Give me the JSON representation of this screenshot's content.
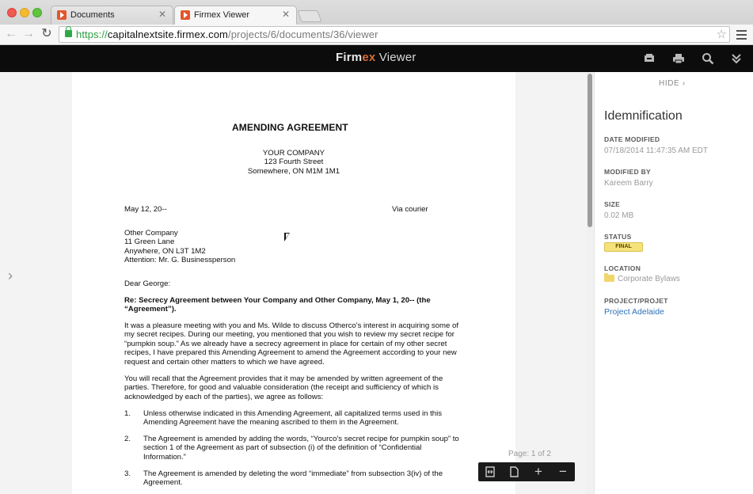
{
  "browser": {
    "tabs": [
      {
        "label": "Documents",
        "active": false
      },
      {
        "label": "Firmex Viewer",
        "active": true
      }
    ],
    "url": {
      "scheme": "https://",
      "host": "capitalnextsite.firmex.com",
      "path": "/projects/6/documents/36/viewer"
    }
  },
  "viewer": {
    "brand_firm": "Firm",
    "brand_x": "ex",
    "brand_viewer": " Viewer",
    "page_info": "Page: 1 of 2"
  },
  "document": {
    "title": "AMENDING AGREEMENT",
    "company": "YOUR COMPANY",
    "street": "123 Fourth Street",
    "city": "Somewhere, ON  M1M 1M1",
    "date": "May 12, 20--",
    "delivery": "Via courier",
    "recipient": [
      "Other Company",
      "11 Green Lane",
      "Anywhere, ON  L3T 1M2",
      "Attention: Mr. G. Businessperson"
    ],
    "salutation": "Dear George:",
    "re_line": "Re: Secrecy Agreement between Your Company and Other Company, May 1, 20-- (the “Agreement”).",
    "para1": "It was a pleasure meeting with you and Ms. Wilde to discuss Otherco's interest in acquiring some of my secret recipes. During our meeting, you mentioned that you wish to review my secret recipe for “pumpkin soup.” As we already have a secrecy agreement in place for certain of my other secret recipes, I have prepared this Amending Agreement to amend the Agreement according to your new request and certain other matters to which we have agreed.",
    "para2": "You will recall that the Agreement provides that it may be amended by written agreement of the parties. Therefore, for good and valuable consideration (the receipt and sufficiency of which is acknowledged by each of the parties), we agree as follows:",
    "items": [
      {
        "num": "1.",
        "text": "Unless otherwise indicated in this Amending Agreement, all capitalized terms used in this Amending Agreement have the meaning ascribed to them in the Agreement."
      },
      {
        "num": "2.",
        "text": "The Agreement is amended by adding the words, “Yourco's secret recipe for pumpkin soup” to section 1 of the Agreement as part of subsection (i) of the definition of “Confidential Information.”"
      },
      {
        "num": "3.",
        "text": "The Agreement is amended by deleting the word “immediate” from subsection 3(iv) of the Agreement."
      }
    ]
  },
  "panel": {
    "hide_label": "HIDE",
    "title": "Idemnification",
    "date_modified_label": "DATE MODIFIED",
    "date_modified": "07/18/2014 11:47:35 AM EDT",
    "modified_by_label": "MODIFIED BY",
    "modified_by": "Kareem Barry",
    "size_label": "SIZE",
    "size": "0.02 MB",
    "status_label": "STATUS",
    "status": "FINAL",
    "location_label": "LOCATION",
    "location": "Corporate Bylaws",
    "project_label": "PROJECT/PROJET",
    "project": "Project Adelaide"
  },
  "colors": {
    "accent_orange": "#d96b35",
    "link_blue": "#2b73b8",
    "status_yellow": "#f6e27a",
    "header_black": "#0c0c0c"
  }
}
